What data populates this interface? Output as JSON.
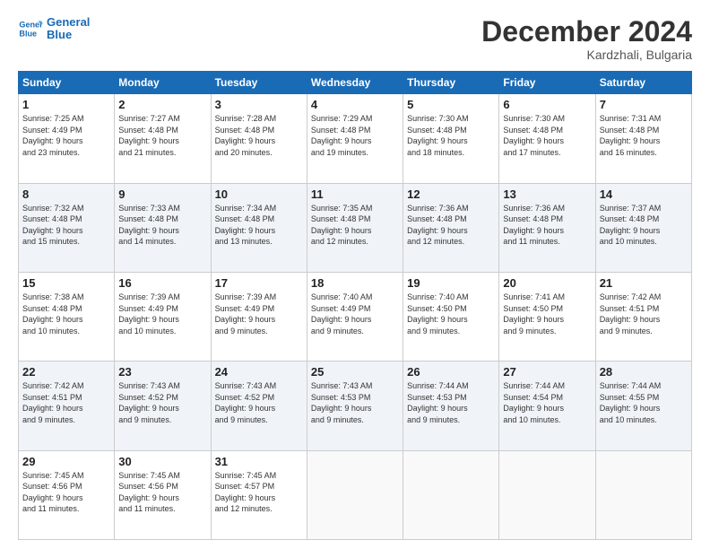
{
  "header": {
    "logo_line1": "General",
    "logo_line2": "Blue",
    "month_title": "December 2024",
    "subtitle": "Kardzhali, Bulgaria"
  },
  "days_of_week": [
    "Sunday",
    "Monday",
    "Tuesday",
    "Wednesday",
    "Thursday",
    "Friday",
    "Saturday"
  ],
  "weeks": [
    [
      {
        "day": "1",
        "info": "Sunrise: 7:25 AM\nSunset: 4:49 PM\nDaylight: 9 hours\nand 23 minutes."
      },
      {
        "day": "2",
        "info": "Sunrise: 7:27 AM\nSunset: 4:48 PM\nDaylight: 9 hours\nand 21 minutes."
      },
      {
        "day": "3",
        "info": "Sunrise: 7:28 AM\nSunset: 4:48 PM\nDaylight: 9 hours\nand 20 minutes."
      },
      {
        "day": "4",
        "info": "Sunrise: 7:29 AM\nSunset: 4:48 PM\nDaylight: 9 hours\nand 19 minutes."
      },
      {
        "day": "5",
        "info": "Sunrise: 7:30 AM\nSunset: 4:48 PM\nDaylight: 9 hours\nand 18 minutes."
      },
      {
        "day": "6",
        "info": "Sunrise: 7:30 AM\nSunset: 4:48 PM\nDaylight: 9 hours\nand 17 minutes."
      },
      {
        "day": "7",
        "info": "Sunrise: 7:31 AM\nSunset: 4:48 PM\nDaylight: 9 hours\nand 16 minutes."
      }
    ],
    [
      {
        "day": "8",
        "info": "Sunrise: 7:32 AM\nSunset: 4:48 PM\nDaylight: 9 hours\nand 15 minutes."
      },
      {
        "day": "9",
        "info": "Sunrise: 7:33 AM\nSunset: 4:48 PM\nDaylight: 9 hours\nand 14 minutes."
      },
      {
        "day": "10",
        "info": "Sunrise: 7:34 AM\nSunset: 4:48 PM\nDaylight: 9 hours\nand 13 minutes."
      },
      {
        "day": "11",
        "info": "Sunrise: 7:35 AM\nSunset: 4:48 PM\nDaylight: 9 hours\nand 12 minutes."
      },
      {
        "day": "12",
        "info": "Sunrise: 7:36 AM\nSunset: 4:48 PM\nDaylight: 9 hours\nand 12 minutes."
      },
      {
        "day": "13",
        "info": "Sunrise: 7:36 AM\nSunset: 4:48 PM\nDaylight: 9 hours\nand 11 minutes."
      },
      {
        "day": "14",
        "info": "Sunrise: 7:37 AM\nSunset: 4:48 PM\nDaylight: 9 hours\nand 10 minutes."
      }
    ],
    [
      {
        "day": "15",
        "info": "Sunrise: 7:38 AM\nSunset: 4:48 PM\nDaylight: 9 hours\nand 10 minutes."
      },
      {
        "day": "16",
        "info": "Sunrise: 7:39 AM\nSunset: 4:49 PM\nDaylight: 9 hours\nand 10 minutes."
      },
      {
        "day": "17",
        "info": "Sunrise: 7:39 AM\nSunset: 4:49 PM\nDaylight: 9 hours\nand 9 minutes."
      },
      {
        "day": "18",
        "info": "Sunrise: 7:40 AM\nSunset: 4:49 PM\nDaylight: 9 hours\nand 9 minutes."
      },
      {
        "day": "19",
        "info": "Sunrise: 7:40 AM\nSunset: 4:50 PM\nDaylight: 9 hours\nand 9 minutes."
      },
      {
        "day": "20",
        "info": "Sunrise: 7:41 AM\nSunset: 4:50 PM\nDaylight: 9 hours\nand 9 minutes."
      },
      {
        "day": "21",
        "info": "Sunrise: 7:42 AM\nSunset: 4:51 PM\nDaylight: 9 hours\nand 9 minutes."
      }
    ],
    [
      {
        "day": "22",
        "info": "Sunrise: 7:42 AM\nSunset: 4:51 PM\nDaylight: 9 hours\nand 9 minutes."
      },
      {
        "day": "23",
        "info": "Sunrise: 7:43 AM\nSunset: 4:52 PM\nDaylight: 9 hours\nand 9 minutes."
      },
      {
        "day": "24",
        "info": "Sunrise: 7:43 AM\nSunset: 4:52 PM\nDaylight: 9 hours\nand 9 minutes."
      },
      {
        "day": "25",
        "info": "Sunrise: 7:43 AM\nSunset: 4:53 PM\nDaylight: 9 hours\nand 9 minutes."
      },
      {
        "day": "26",
        "info": "Sunrise: 7:44 AM\nSunset: 4:53 PM\nDaylight: 9 hours\nand 9 minutes."
      },
      {
        "day": "27",
        "info": "Sunrise: 7:44 AM\nSunset: 4:54 PM\nDaylight: 9 hours\nand 10 minutes."
      },
      {
        "day": "28",
        "info": "Sunrise: 7:44 AM\nSunset: 4:55 PM\nDaylight: 9 hours\nand 10 minutes."
      }
    ],
    [
      {
        "day": "29",
        "info": "Sunrise: 7:45 AM\nSunset: 4:56 PM\nDaylight: 9 hours\nand 11 minutes."
      },
      {
        "day": "30",
        "info": "Sunrise: 7:45 AM\nSunset: 4:56 PM\nDaylight: 9 hours\nand 11 minutes."
      },
      {
        "day": "31",
        "info": "Sunrise: 7:45 AM\nSunset: 4:57 PM\nDaylight: 9 hours\nand 12 minutes."
      },
      {
        "day": "",
        "info": ""
      },
      {
        "day": "",
        "info": ""
      },
      {
        "day": "",
        "info": ""
      },
      {
        "day": "",
        "info": ""
      }
    ]
  ]
}
